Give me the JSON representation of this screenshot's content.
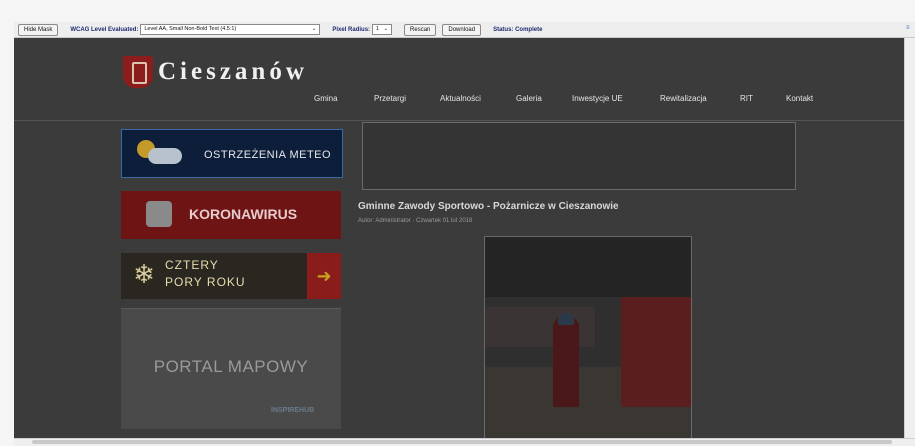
{
  "toolbar": {
    "hide_mask_label": "Hide Mask",
    "wcag_label": "WCAG Level Evaluated:",
    "wcag_value": "Level AA, Small Non-Bold Text (4.5:1)",
    "pixel_radius_label": "Pixel Radius:",
    "pixel_radius_value": "1",
    "rescan_label": "Rescan",
    "download_label": "Download",
    "status_label": "Status: Complete"
  },
  "site": {
    "logo_text": "Cieszanów",
    "nav": [
      "Gmina",
      "Przetargi",
      "Aktualności",
      "Galeria",
      "Inwestycje UE",
      "Rewitalizacja",
      "RIT",
      "Kontakt"
    ]
  },
  "banners": {
    "meteo": "OSTRZEŻENIA METEO",
    "corona": "KORONAWIRUS",
    "cztery_line1": "CZTERY",
    "cztery_line2": "PORY ROKU",
    "mapa": "PORTAL MAPOWY",
    "mapa_hub": "INSPIREHUB"
  },
  "article": {
    "title": "Gminne Zawody Sportowo - Pożarnicze w Cieszanowie",
    "meta": "Autor: Administrator · Czwartek 01 lut 2018"
  },
  "colors": {
    "page_bg": "#3b3b3b",
    "toolbar_text": "#1e2a6e",
    "accent_red": "#8c1d1d"
  }
}
